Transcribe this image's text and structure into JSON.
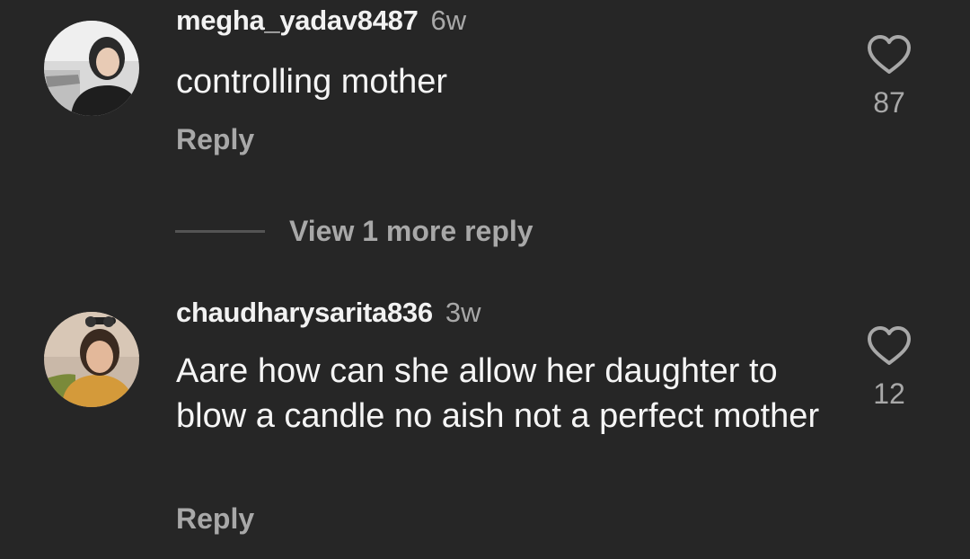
{
  "comments": [
    {
      "username": "megha_yadav8487",
      "time": "6w",
      "text": "controlling mother",
      "reply_label": "Reply",
      "likes": "87",
      "avatar_icon": "profile-photo-woman"
    },
    {
      "username": "chaudharysarita836",
      "time": "3w",
      "text": "Aare how can she allow her daughter to blow a candle no aish not a perfect mother",
      "reply_label": "Reply",
      "likes": "12",
      "avatar_icon": "profile-photo-woman-sunglasses"
    }
  ],
  "view_more": {
    "label": "View 1 more reply"
  },
  "colors": {
    "background": "#262626",
    "primary_text": "#f5f5f5",
    "secondary_text": "#a8a8a8"
  }
}
